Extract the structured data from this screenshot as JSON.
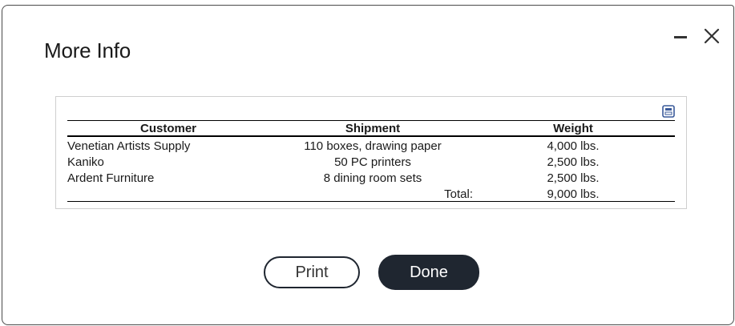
{
  "dialog": {
    "title": "More Info"
  },
  "controls": {
    "minimize_icon": "minimize-icon",
    "close_icon": "close-icon",
    "popout_icon": "popout-icon"
  },
  "table": {
    "headers": [
      "Customer",
      "Shipment",
      "Weight"
    ],
    "rows": [
      {
        "customer": "Venetian Artists Supply",
        "shipment": "110 boxes, drawing paper",
        "weight": "4,000 lbs."
      },
      {
        "customer": "Kaniko",
        "shipment": "50 PC printers",
        "weight": "2,500 lbs."
      },
      {
        "customer": "Ardent Furniture",
        "shipment": "8 dining room sets",
        "weight": "2,500 lbs."
      }
    ],
    "total_label": "Total:",
    "total_weight": "9,000 lbs."
  },
  "buttons": {
    "print_label": "Print",
    "done_label": "Done"
  },
  "colors": {
    "button_dark": "#1f2630",
    "border": "#4a4a4a",
    "popout_icon_blue": "#3a5a9a"
  }
}
